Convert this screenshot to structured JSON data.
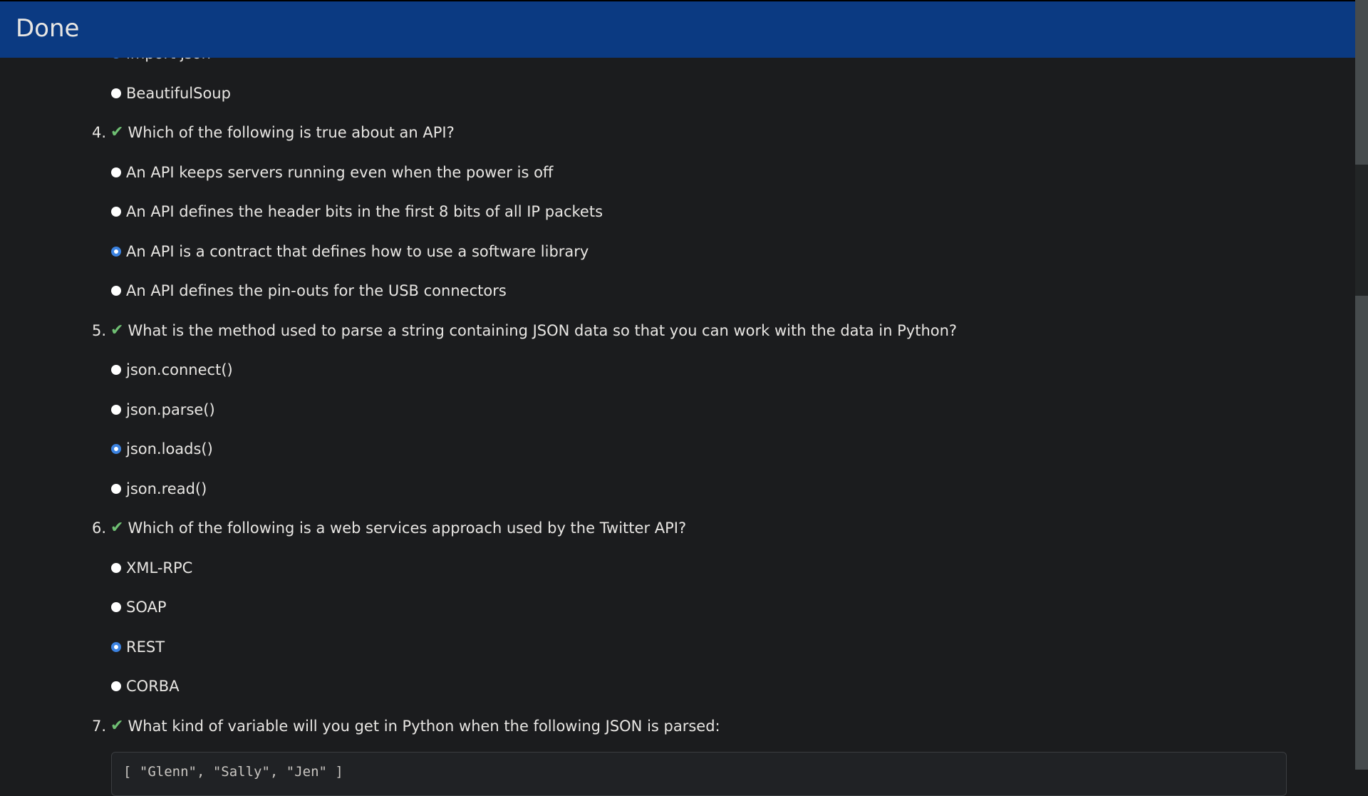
{
  "header": {
    "title": "Done"
  },
  "prev_options": [
    {
      "label": "import json",
      "selected": true
    },
    {
      "label": "BeautifulSoup",
      "selected": false
    }
  ],
  "questions": [
    {
      "number": "4.",
      "text": "Which of the following is true about an API?",
      "options": [
        {
          "label": "An API keeps servers running even when the power is off",
          "selected": false
        },
        {
          "label": "An API defines the header bits in the first 8 bits of all IP packets",
          "selected": false
        },
        {
          "label": "An API is a contract that defines how to use a software library",
          "selected": true
        },
        {
          "label": "An API defines the pin-outs for the USB connectors",
          "selected": false
        }
      ]
    },
    {
      "number": "5.",
      "text": "What is the method used to parse a string containing JSON data so that you can work with the data in Python?",
      "options": [
        {
          "label": "json.connect()",
          "selected": false
        },
        {
          "label": "json.parse()",
          "selected": false
        },
        {
          "label": "json.loads()",
          "selected": true
        },
        {
          "label": "json.read()",
          "selected": false
        }
      ]
    },
    {
      "number": "6.",
      "text": "Which of the following is a web services approach used by the Twitter API?",
      "options": [
        {
          "label": "XML-RPC",
          "selected": false
        },
        {
          "label": "SOAP",
          "selected": false
        },
        {
          "label": "REST",
          "selected": true
        },
        {
          "label": "CORBA",
          "selected": false
        }
      ]
    },
    {
      "number": "7.",
      "text": "What kind of variable will you get in Python when the following JSON is parsed:",
      "code": "[ \"Glenn\", \"Sally\", \"Jen\" ]"
    }
  ],
  "colors": {
    "header": "#0b3a82",
    "check": "#6fbf73",
    "radio_selected": "#3b82e0"
  }
}
